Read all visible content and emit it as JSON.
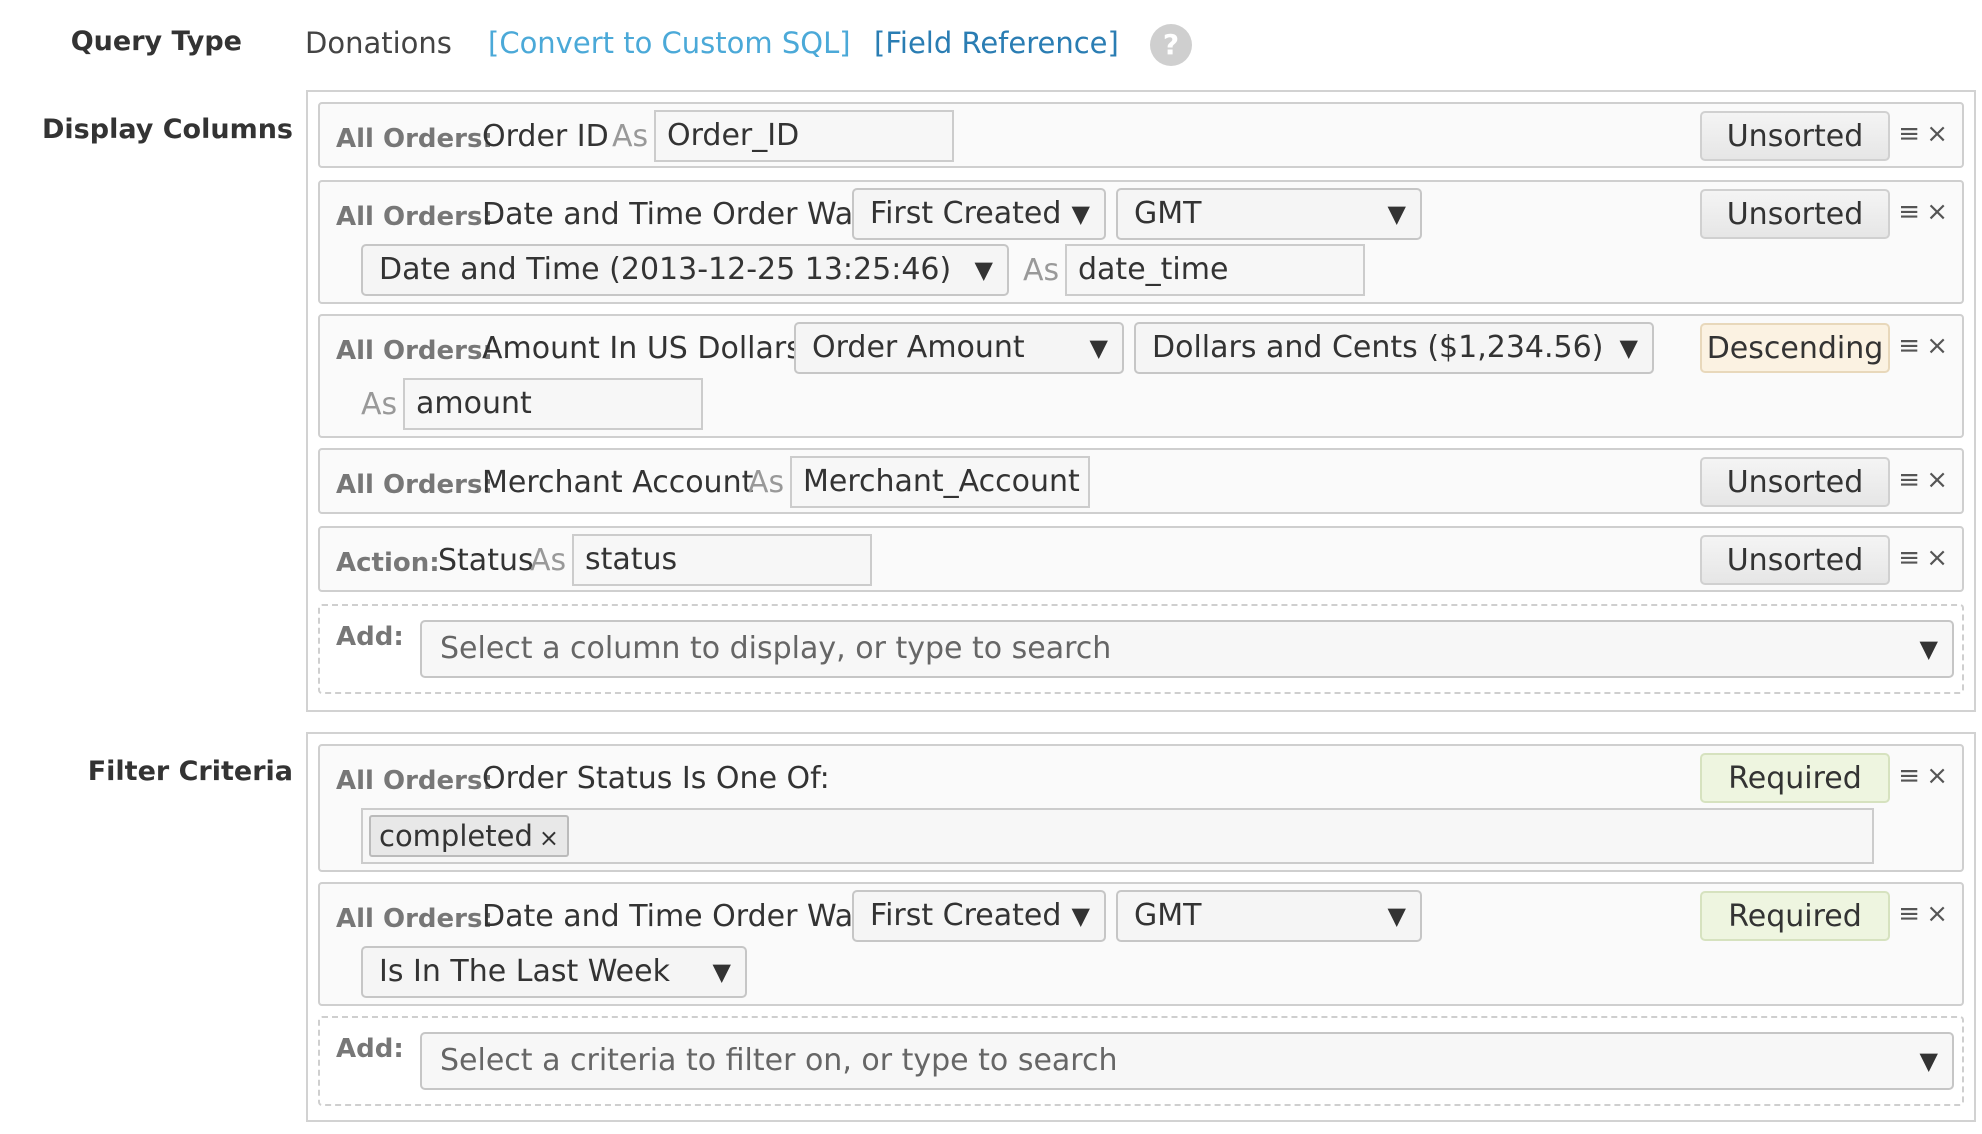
{
  "query_type": {
    "label": "Query Type",
    "value": "Donations",
    "convert_link": "[Convert to Custom SQL]",
    "reference_link": "[Field Reference]",
    "help_glyph": "?"
  },
  "display_columns": {
    "label": "Display Columns",
    "rows": [
      {
        "prefix": "All Orders:",
        "field": "Order ID",
        "as": "As",
        "alias": "Order_ID",
        "sort": "Unsorted"
      },
      {
        "prefix": "All Orders:",
        "field": "Date and Time Order Was",
        "select1": "First Created",
        "select2": "GMT",
        "select3": "Date and Time (2013-12-25 13:25:46)",
        "as": "As",
        "alias": "date_time",
        "sort": "Unsorted"
      },
      {
        "prefix": "All Orders:",
        "field": "Amount In US Dollars",
        "select1": "Order Amount",
        "select2": "Dollars and Cents ($1,234.56)",
        "as": "As",
        "alias": "amount",
        "sort": "Descending"
      },
      {
        "prefix": "All Orders:",
        "field": "Merchant Account",
        "as": "As",
        "alias": "Merchant_Account",
        "sort": "Unsorted"
      },
      {
        "prefix": "Action:",
        "field": "Status",
        "as": "As",
        "alias": "status",
        "sort": "Unsorted"
      }
    ],
    "add": {
      "label": "Add:",
      "placeholder": "Select a column to display, or type to search"
    }
  },
  "filter_criteria": {
    "label": "Filter Criteria",
    "rows": [
      {
        "prefix": "All Orders:",
        "field": "Order Status Is One Of:",
        "tag": "completed",
        "tag_remove": "×",
        "sort": "Required"
      },
      {
        "prefix": "All Orders:",
        "field": "Date and Time Order Was",
        "select1": "First Created",
        "select2": "GMT",
        "select3": "Is In The Last Week",
        "sort": "Required"
      }
    ],
    "add": {
      "label": "Add:",
      "placeholder": "Select a criteria to filter on, or type to search"
    }
  },
  "icons": {
    "caret": "▼",
    "drag": "≡",
    "remove": "×"
  },
  "colors": {
    "link_light": "#4ba9d8",
    "link_dark": "#2a7db3",
    "descending_bg": "#fbf2e2",
    "required_bg": "#eef5e0"
  }
}
